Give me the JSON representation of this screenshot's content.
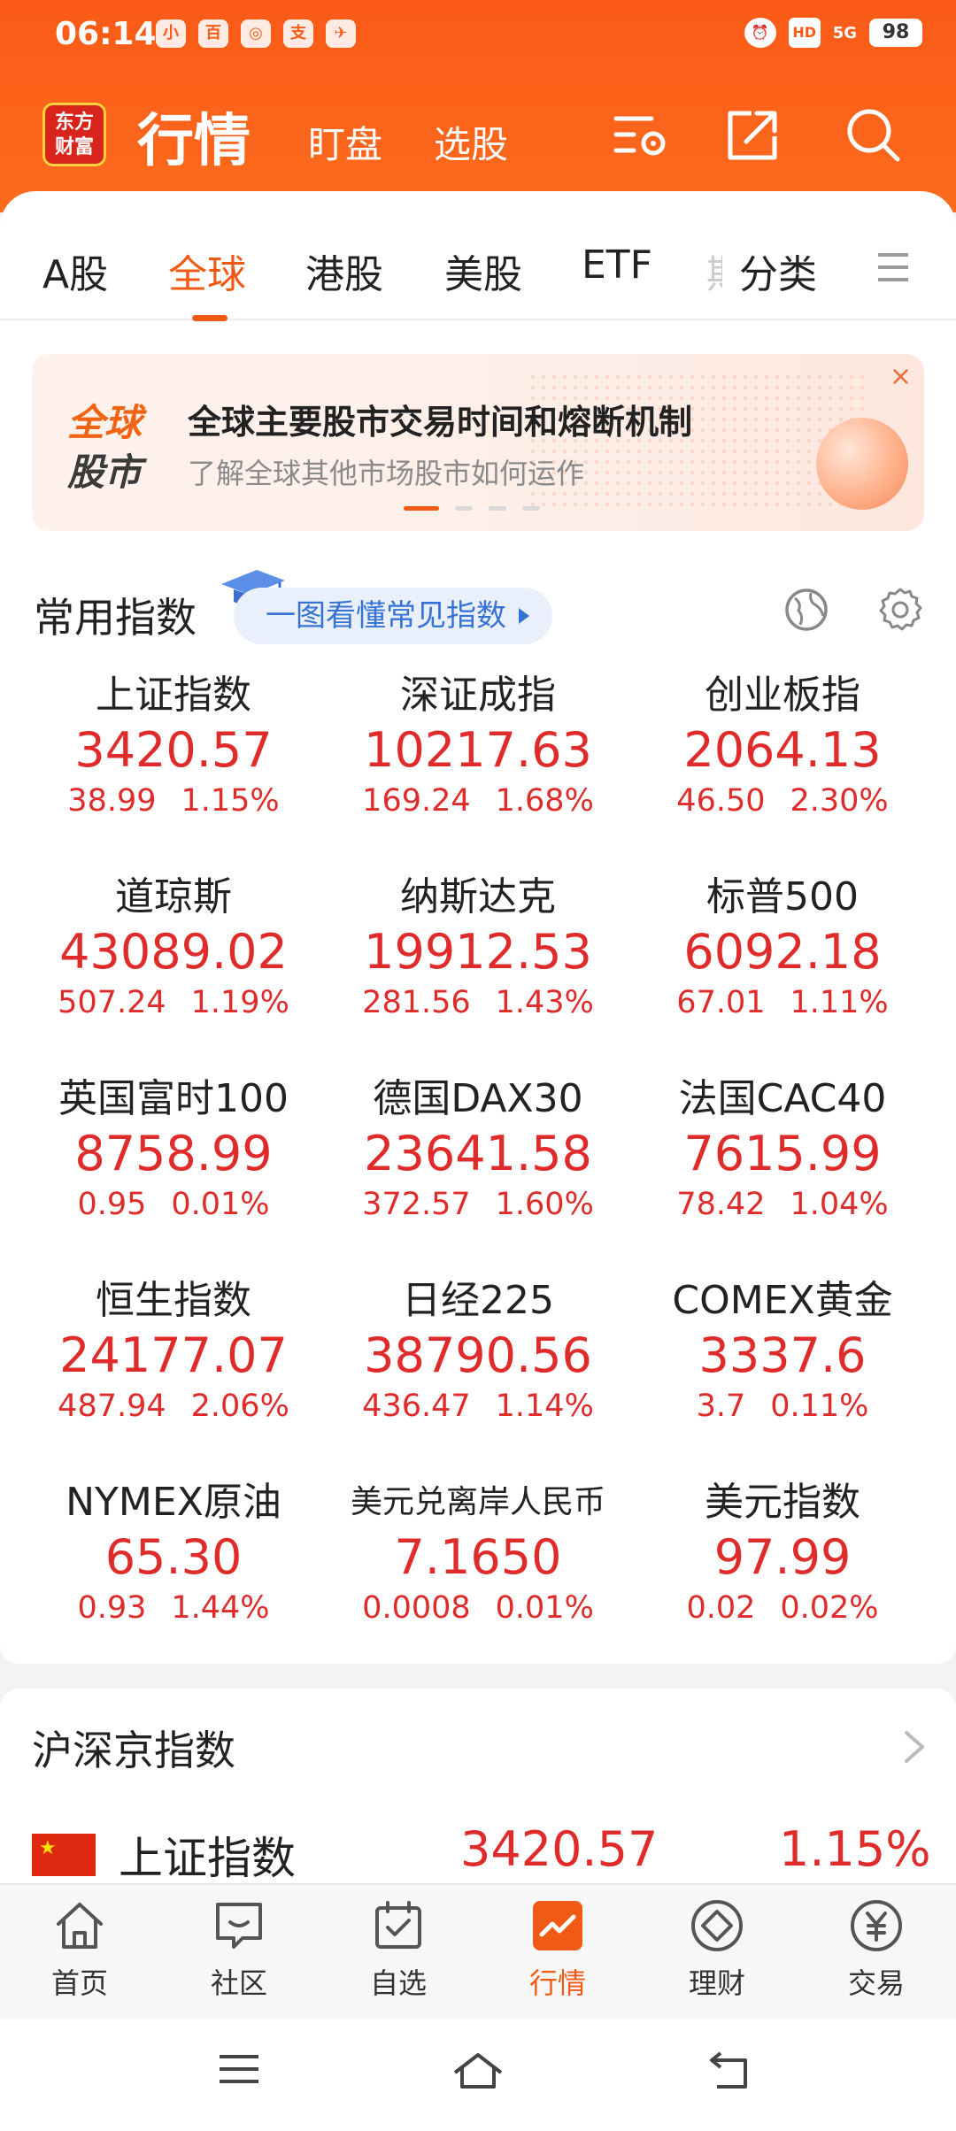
{
  "status": {
    "time": "06:14",
    "net": "5G",
    "battery": "98"
  },
  "header": {
    "logo": "东方\n财富",
    "title": "行情",
    "links": [
      "盯盘",
      "选股"
    ]
  },
  "tabs": [
    "A股",
    "全球",
    "港股",
    "美股",
    "ETF",
    "期",
    "分类"
  ],
  "active_tab": "全球",
  "banner": {
    "label_top": "全球",
    "label_bottom": "股市",
    "title": "全球主要股市交易时间和熔断机制",
    "subtitle": "了解全球其他市场股市如何运作",
    "close": "×"
  },
  "common_indices": {
    "title": "常用指数",
    "learn_label": "一图看懂常见指数",
    "items": [
      {
        "name": "上证指数",
        "price": "3420.57",
        "change": "38.99",
        "pct": "1.15%"
      },
      {
        "name": "深证成指",
        "price": "10217.63",
        "change": "169.24",
        "pct": "1.68%"
      },
      {
        "name": "创业板指",
        "price": "2064.13",
        "change": "46.50",
        "pct": "2.30%"
      },
      {
        "name": "道琼斯",
        "price": "43089.02",
        "change": "507.24",
        "pct": "1.19%"
      },
      {
        "name": "纳斯达克",
        "price": "19912.53",
        "change": "281.56",
        "pct": "1.43%"
      },
      {
        "name": "标普500",
        "price": "6092.18",
        "change": "67.01",
        "pct": "1.11%"
      },
      {
        "name": "英国富时100",
        "price": "8758.99",
        "change": "0.95",
        "pct": "0.01%"
      },
      {
        "name": "德国DAX30",
        "price": "23641.58",
        "change": "372.57",
        "pct": "1.60%"
      },
      {
        "name": "法国CAC40",
        "price": "7615.99",
        "change": "78.42",
        "pct": "1.04%"
      },
      {
        "name": "恒生指数",
        "price": "24177.07",
        "change": "487.94",
        "pct": "2.06%"
      },
      {
        "name": "日经225",
        "price": "38790.56",
        "change": "436.47",
        "pct": "1.14%"
      },
      {
        "name": "COMEX黄金",
        "price": "3337.6",
        "change": "3.7",
        "pct": "0.11%"
      },
      {
        "name": "NYMEX原油",
        "price": "65.30",
        "change": "0.93",
        "pct": "1.44%"
      },
      {
        "name": "美元兑离岸人民币",
        "price": "7.1650",
        "change": "0.0008",
        "pct": "0.01%"
      },
      {
        "name": "美元指数",
        "price": "97.99",
        "change": "0.02",
        "pct": "0.02%"
      }
    ]
  },
  "hsj": {
    "title": "沪深京指数",
    "row": {
      "name": "上证指数",
      "price": "3420.57",
      "pct": "1.15%"
    }
  },
  "bottom_nav": [
    "首页",
    "社区",
    "自选",
    "行情",
    "理财",
    "交易"
  ],
  "colors": {
    "accent": "#f05a15",
    "up": "#e02b2b",
    "header": "#fb5a17"
  }
}
